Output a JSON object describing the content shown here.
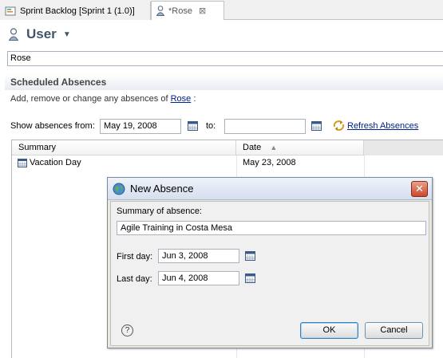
{
  "tabs": [
    {
      "label": "Sprint Backlog [Sprint 1 (1.0)]",
      "icon": "backlog-icon"
    },
    {
      "label": "*Rose",
      "icon": "user-icon",
      "close": "⊠"
    }
  ],
  "header": {
    "title": "User",
    "icon": "user-icon"
  },
  "user_name": "Rose",
  "section": {
    "title": "Scheduled Absences",
    "description_prefix": "Add, remove or change any absences of",
    "description_link": "Rose",
    "description_suffix": ":",
    "show_from_label": "Show absences from:",
    "from_date": "May 19, 2008",
    "to_label": "to:",
    "to_date": "",
    "refresh_label": "Refresh Absences"
  },
  "table": {
    "columns": [
      "Summary",
      "Date"
    ],
    "rows": [
      {
        "summary": "Vacation Day",
        "date": "May 23, 2008"
      }
    ]
  },
  "dialog": {
    "title": "New Absence",
    "close": "✕",
    "summary_label": "Summary of absence:",
    "summary_value": "Agile Training in Costa Mesa",
    "first_day_label": "First day:",
    "first_day": "Jun 3, 2008",
    "last_day_label": "Last day:",
    "last_day": "Jun 4, 2008",
    "help": "?",
    "ok": "OK",
    "cancel": "Cancel"
  },
  "colors": {
    "link": "#00238c",
    "title": "#42556b",
    "close_button": "#c84a2c"
  }
}
